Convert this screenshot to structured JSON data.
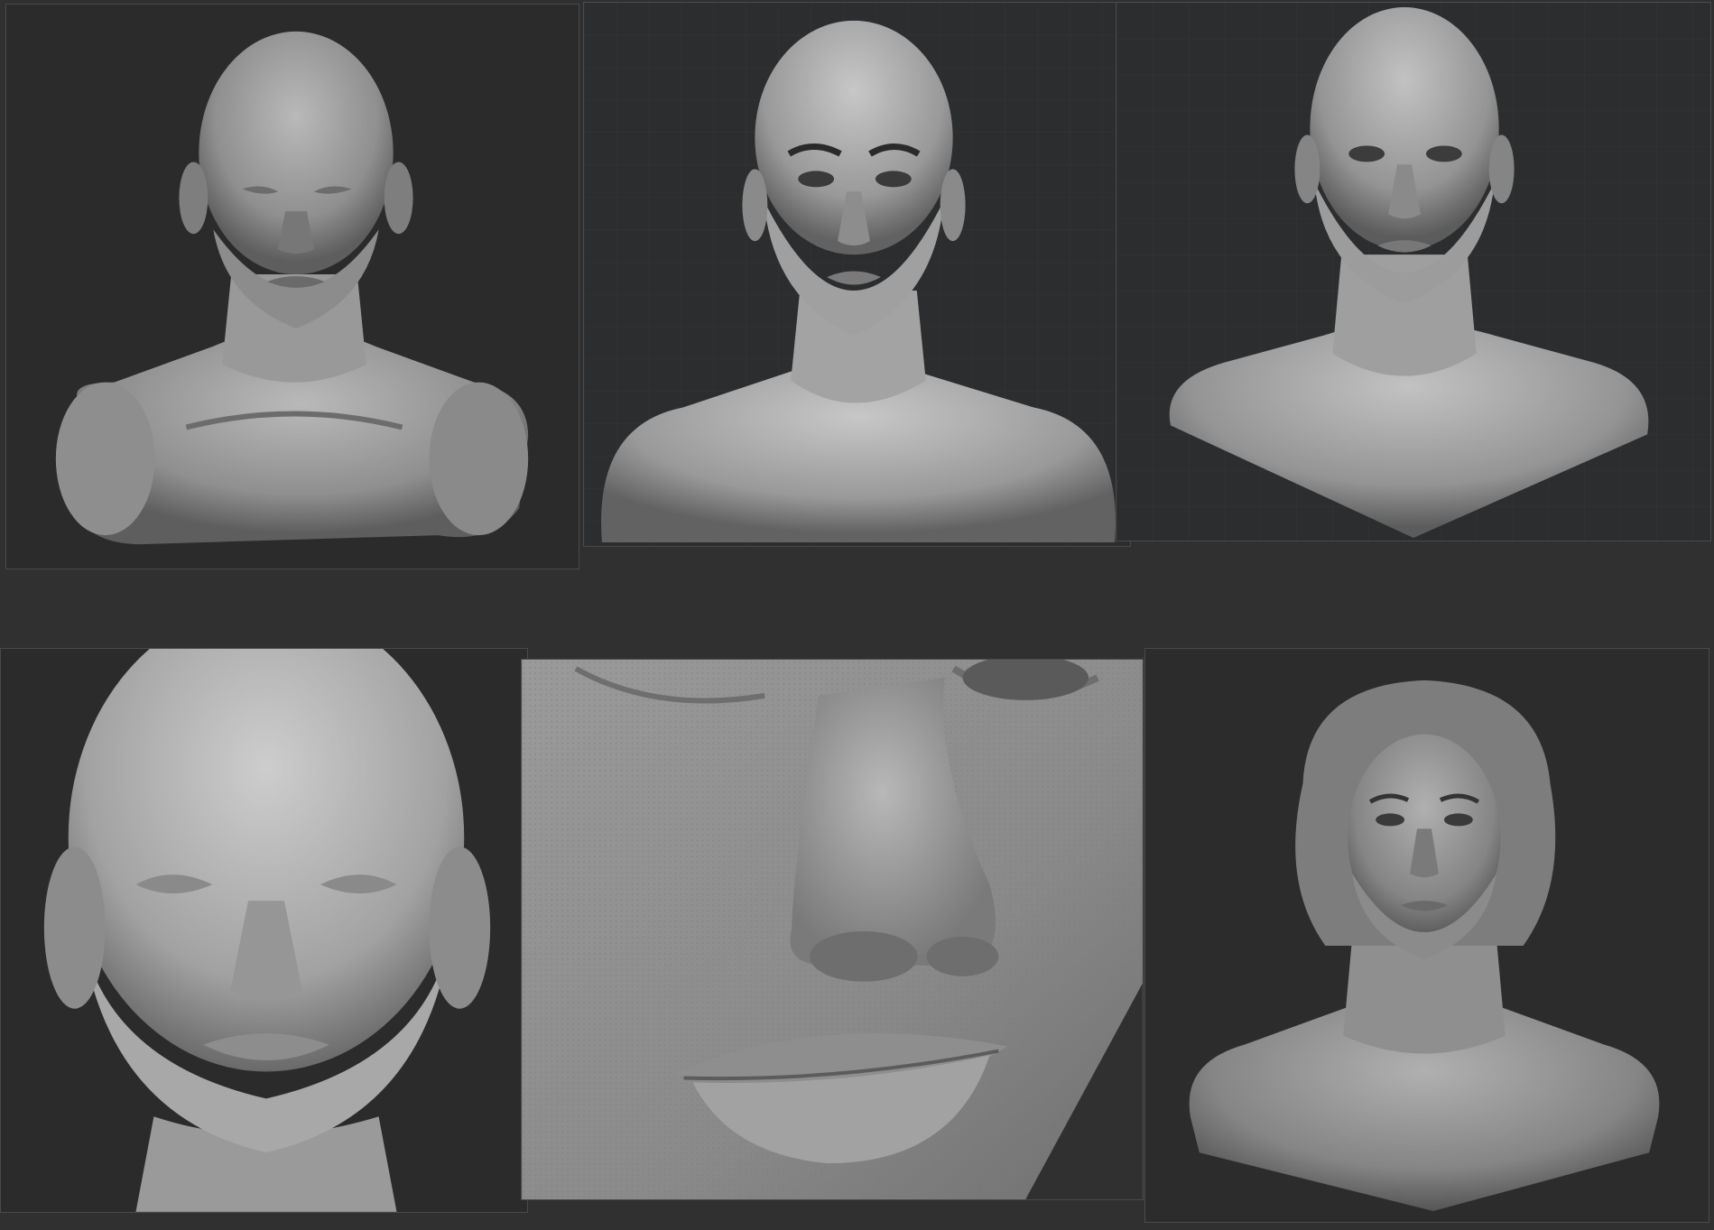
{
  "canvas": {
    "background": "#303031"
  },
  "panels": [
    {
      "id": "bust-blockout",
      "icon": "low-poly-female-bust",
      "base_color": "#a8a8a8"
    },
    {
      "id": "bust-refined-brows",
      "icon": "refined-female-bust-with-brows",
      "base_color": "#b4b4b4"
    },
    {
      "id": "bust-refined-eyes",
      "icon": "refined-female-bust-open-eyes",
      "base_color": "#b0b0b0"
    },
    {
      "id": "face-closeup",
      "icon": "female-face-closeup-closed-eyes",
      "base_color": "#b8b8b8"
    },
    {
      "id": "skin-detail-nose-lips",
      "icon": "skin-pore-detail-nose-lips",
      "base_color": "#9c9c9c"
    },
    {
      "id": "bust-with-hair",
      "icon": "female-bust-with-hair",
      "base_color": "#9a9a9a"
    }
  ]
}
